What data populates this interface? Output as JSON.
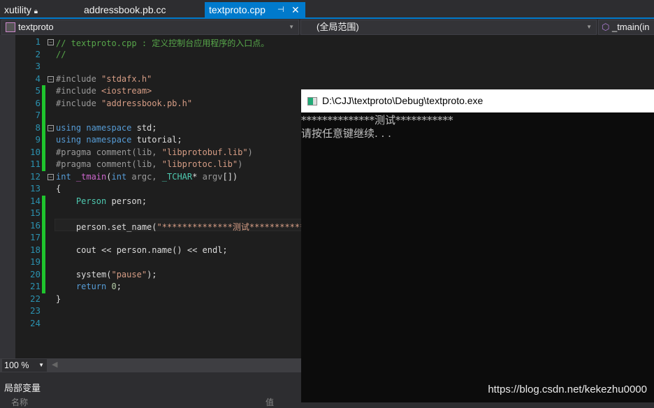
{
  "tabs": [
    {
      "label": "xutility",
      "icon": "lock-icon"
    },
    {
      "label": "addressbook.pb.cc"
    },
    {
      "label": "textproto.cpp",
      "active": true,
      "icons": [
        "pin-icon",
        "close-icon"
      ]
    }
  ],
  "nav": {
    "project": "textproto",
    "scope": "(全局范围)",
    "member": "_tmain(in"
  },
  "lines": [
    {
      "n": "1",
      "t": [
        [
          "cm",
          "// textproto.cpp : 定义控制台应用程序的入口点。"
        ]
      ]
    },
    {
      "n": "2",
      "t": [
        [
          "cm",
          "//"
        ]
      ]
    },
    {
      "n": "3",
      "t": []
    },
    {
      "n": "4",
      "t": [
        [
          "pp",
          "#include "
        ],
        [
          "st",
          "\"stdafx.h\""
        ]
      ]
    },
    {
      "n": "5",
      "t": [
        [
          "pp",
          "#include "
        ],
        [
          "st",
          "<iostream>"
        ]
      ]
    },
    {
      "n": "6",
      "t": [
        [
          "pp",
          "#include "
        ],
        [
          "st",
          "\"addressbook.pb.h\""
        ]
      ]
    },
    {
      "n": "7",
      "t": []
    },
    {
      "n": "8",
      "t": [
        [
          "kw",
          "using namespace "
        ],
        [
          "",
          "std;"
        ]
      ]
    },
    {
      "n": "9",
      "t": [
        [
          "kw",
          "using namespace "
        ],
        [
          "",
          "tutorial;"
        ]
      ]
    },
    {
      "n": "10",
      "t": [
        [
          "pp",
          "#pragma comment(lib, "
        ],
        [
          "st",
          "\"libprotobuf.lib\""
        ],
        [
          "pp",
          ")"
        ]
      ]
    },
    {
      "n": "11",
      "t": [
        [
          "pp",
          "#pragma comment(lib, "
        ],
        [
          "st",
          "\"libprotoc.lib\""
        ],
        [
          "pp",
          ")"
        ]
      ]
    },
    {
      "n": "12",
      "t": [
        [
          "kw",
          "int "
        ],
        [
          "fn",
          "_tmain"
        ],
        [
          "",
          "("
        ],
        [
          "kw",
          "int "
        ],
        [
          "pp",
          "argc, "
        ],
        [
          "ty",
          "_TCHAR"
        ],
        [
          "",
          "* "
        ],
        [
          "pp",
          "argv"
        ],
        [
          "",
          "[])"
        ]
      ]
    },
    {
      "n": "13",
      "t": [
        [
          "",
          "{"
        ]
      ]
    },
    {
      "n": "14",
      "t": [
        [
          "",
          "    "
        ],
        [
          "ty",
          "Person"
        ],
        [
          "",
          " person;"
        ]
      ]
    },
    {
      "n": "15",
      "t": []
    },
    {
      "n": "16",
      "t": [
        [
          "",
          "    person.set_name("
        ],
        [
          "st",
          "\"**************测试***********\""
        ],
        [
          "",
          ");"
        ]
      ]
    },
    {
      "n": "17",
      "t": []
    },
    {
      "n": "18",
      "t": [
        [
          "",
          "    cout << person.name() << endl;"
        ]
      ]
    },
    {
      "n": "19",
      "t": []
    },
    {
      "n": "20",
      "t": [
        [
          "",
          "    system("
        ],
        [
          "st",
          "\"pause\""
        ],
        [
          "",
          ");"
        ]
      ]
    },
    {
      "n": "21",
      "t": [
        [
          "",
          "    "
        ],
        [
          "kw",
          "return "
        ],
        [
          "nm",
          "0"
        ],
        [
          "",
          ";"
        ]
      ]
    },
    {
      "n": "22",
      "t": [
        [
          "",
          "}"
        ]
      ]
    },
    {
      "n": "23",
      "t": []
    },
    {
      "n": "24",
      "t": []
    }
  ],
  "zoom": "100 %",
  "panel": {
    "title": "局部变量",
    "col_name": "名称",
    "col_value": "值"
  },
  "console": {
    "title": "D:\\CJJ\\textproto\\Debug\\textproto.exe",
    "lines": [
      "**************测试***********",
      "请按任意键继续. . ."
    ]
  },
  "watermark": "https://blog.csdn.net/kekezhu0000",
  "colors": {
    "accent": "#007acc",
    "changed": "#1fc52d"
  }
}
